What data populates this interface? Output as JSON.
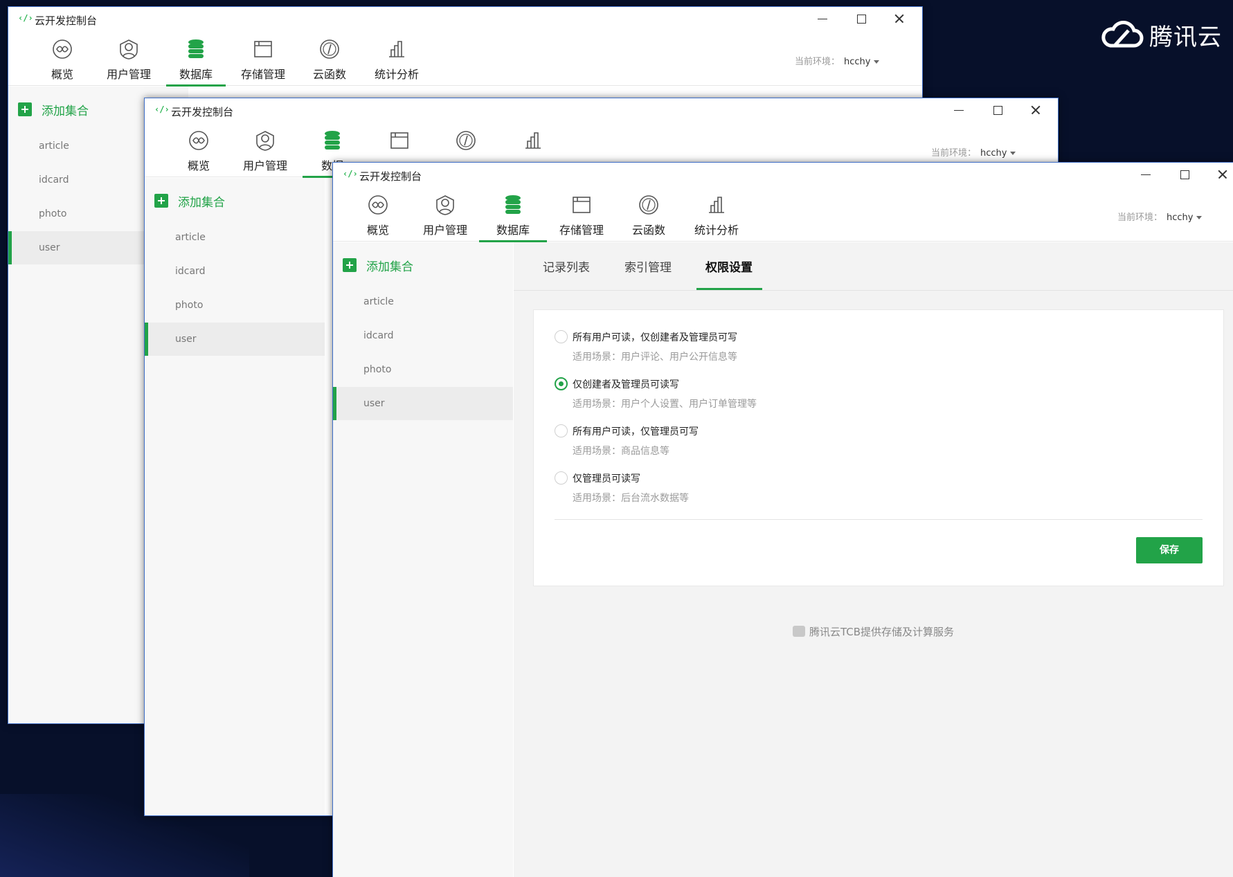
{
  "brand": {
    "name": "腾讯云"
  },
  "app": {
    "title": "云开发控制台",
    "env_label": "当前环境：",
    "env_value": "hcchy",
    "nav": [
      {
        "label": "概览",
        "icon": "overview-icon"
      },
      {
        "label": "用户管理",
        "icon": "user-icon"
      },
      {
        "label": "数据库",
        "icon": "database-icon"
      },
      {
        "label": "存储管理",
        "icon": "storage-icon"
      },
      {
        "label": "云函数",
        "icon": "cloud-function-icon"
      },
      {
        "label": "统计分析",
        "icon": "statistics-icon"
      }
    ],
    "nav_truncated_label": "数据",
    "add_collection": "添加集合",
    "collections": [
      "article",
      "idcard",
      "photo",
      "user"
    ],
    "active_collection": "user"
  },
  "content": {
    "tabs": [
      "记录列表",
      "索引管理",
      "权限设置"
    ],
    "active_tab": "权限设置",
    "options": [
      {
        "title": "所有用户可读，仅创建者及管理员可写",
        "desc": "适用场景：用户评论、用户公开信息等",
        "selected": false
      },
      {
        "title": "仅创建者及管理员可读写",
        "desc": "适用场景：用户个人设置、用户订单管理等",
        "selected": true
      },
      {
        "title": "所有用户可读，仅管理员可写",
        "desc": "适用场景：商品信息等",
        "selected": false
      },
      {
        "title": "仅管理员可读写",
        "desc": "适用场景：后台流水数据等",
        "selected": false
      }
    ],
    "save_label": "保存",
    "footer": "腾讯云TCB提供存储及计算服务"
  },
  "colors": {
    "accent": "#22a348",
    "background": "#07102a",
    "window_border": "#3f6fc8"
  }
}
